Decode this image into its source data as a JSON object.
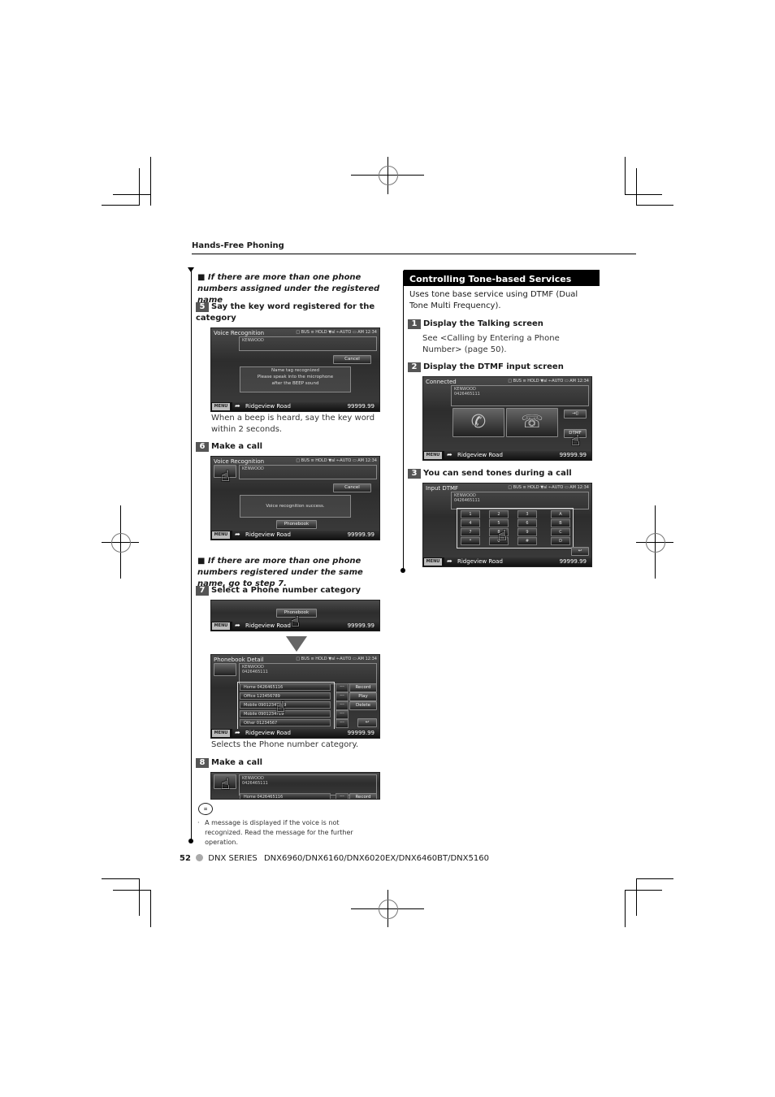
{
  "header": {
    "section": "Hands-Free Phoning"
  },
  "left": {
    "note1": "■ If there are more than one phone numbers assigned under the registered name",
    "step5": {
      "num": "5",
      "label": "Say the key word registered for the category"
    },
    "screen1": {
      "title": "Voice Recognition",
      "status": "□ BUS ≡ HOLD ▼al  ←AUTO ▭ AM 12:34",
      "name": "KENWOOD",
      "cancel": "Cancel",
      "message": [
        "Name tag recognized",
        "Please speak into the microphone",
        "after the BEEP sound"
      ],
      "menu": "MENU",
      "road": "Ridgeview Road",
      "distance": "99999.99"
    },
    "step5_desc": "When a beep is heard, say the key word within 2 seconds.",
    "step6": {
      "num": "6",
      "label": "Make a call"
    },
    "screen2": {
      "title": "Voice Recognition",
      "status": "□ BUS ≡ HOLD ▼al  ←AUTO ▭ AM 12:34",
      "name": "KENWOOD",
      "cancel": "Cancel",
      "message": "Voice recognition success.",
      "phonebook": "Phonebook",
      "menu": "MENU",
      "road": "Ridgeview Road",
      "distance": "99999.99"
    },
    "note2": "■ If there are more than one phone numbers registered under the same name, go to step 7.",
    "step7": {
      "num": "7",
      "label": "Select a Phone number category"
    },
    "screen3": {
      "phonebook": "Phonebook",
      "menu": "MENU",
      "road": "Ridgeview Road",
      "distance": "99999.99"
    },
    "screen4": {
      "title": "Phonebook Detail",
      "status": "□ BUS ≡ HOLD ▼al  ←AUTO ▭ AM 12:34",
      "name": "KENWOOD",
      "number": "0426465111",
      "rows": [
        "Home  0426465116",
        "Office  123456789",
        "Mobile  0901234?729",
        "Mobile  0901234?19",
        "Other  01234567"
      ],
      "side_buttons": [
        "Record",
        "Play",
        "Delete"
      ],
      "menu": "MENU",
      "road": "Ridgeview Road",
      "distance": "99999.99"
    },
    "step7_desc": "Selects the Phone number category.",
    "step8": {
      "num": "8",
      "label": "Make a call"
    },
    "screen5": {
      "name": "KENWOOD",
      "number": "0426465111",
      "row": "Home  0426465116",
      "record": "Record"
    },
    "note_bullet": "A message is displayed if the voice is not recognized. Read the message for the further operation."
  },
  "right": {
    "section_title": "Controlling Tone-based Services",
    "intro": "Uses tone base service using DTMF (Dual Tone Multi Frequency).",
    "step1": {
      "num": "1",
      "label": "Display the Talking screen"
    },
    "step1_desc": "See <Calling by Entering a Phone Number> (page 50).",
    "step2": {
      "num": "2",
      "label": "Display the DTMF input screen"
    },
    "screen6": {
      "title": "Connected",
      "status": "□ BUS ≡ HOLD ▼al  ←AUTO ▭ AM 12:34",
      "name": "KENWOOD",
      "number": "0426465111",
      "dtmf": "DTMF",
      "switch": "→▯",
      "menu": "MENU",
      "road": "Ridgeview Road",
      "distance": "99999.99"
    },
    "step3": {
      "num": "3",
      "label": "You can send tones during a call"
    },
    "screen7": {
      "title": "Input DTMF",
      "status": "□ BUS ≡ HOLD ▼al  ←AUTO ▭ AM 12:34",
      "name": "KENWOOD",
      "number": "0426465111",
      "keys": [
        "1",
        "2",
        "3",
        "A",
        "4",
        "5",
        "6",
        "B",
        "7",
        "8",
        "9",
        "C",
        "*",
        "0",
        "#",
        "D"
      ],
      "menu": "MENU",
      "road": "Ridgeview Road",
      "distance": "99999.99"
    }
  },
  "footer": {
    "page": "52",
    "series": "DNX SERIES",
    "models": "DNX6960/DNX6160/DNX6020EX/DNX6460BT/DNX5160"
  }
}
